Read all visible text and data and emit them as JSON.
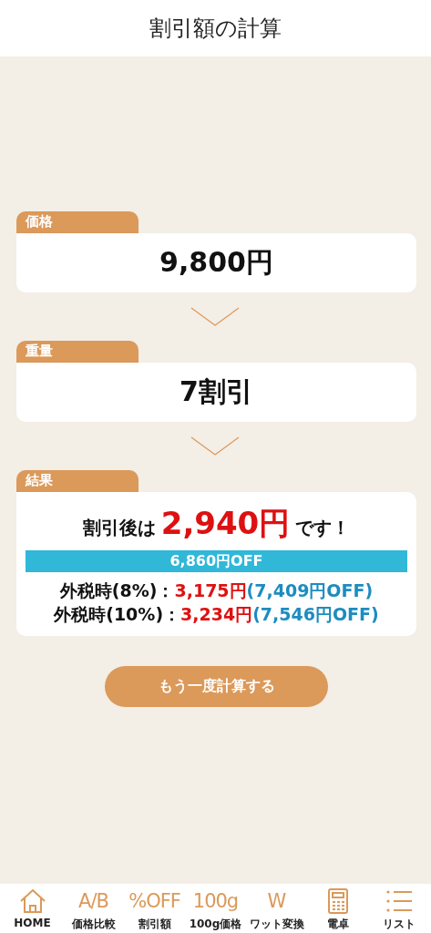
{
  "header": {
    "title": "割引額の計算"
  },
  "sections": [
    {
      "kind": "value",
      "label": "価格",
      "value": "9,800円"
    },
    {
      "kind": "value",
      "label": "重量",
      "value": "7割引"
    },
    {
      "kind": "result",
      "label": "結果",
      "prefix": "割引後は",
      "amount": "2,940円",
      "suffix": "です！",
      "off_banner": "6,860円OFF",
      "tax_rows": [
        {
          "label": "外税時(8%)：",
          "price": "3,175円",
          "off": "(7,409円OFF)"
        },
        {
          "label": "外税時(10%)：",
          "price": "3,234円",
          "off": "(7,546円OFF)"
        }
      ]
    }
  ],
  "button": {
    "label": "もう一度計算する"
  },
  "nav": [
    {
      "kind": "home",
      "label": "HOME"
    },
    {
      "kind": "text",
      "glyph": "A/B",
      "label": "価格比較"
    },
    {
      "kind": "text",
      "glyph": "%OFF",
      "label": "割引額"
    },
    {
      "kind": "text",
      "glyph": "100g",
      "label": "100g価格"
    },
    {
      "kind": "text",
      "glyph": "W",
      "label": "ワット変換"
    },
    {
      "kind": "calculator",
      "label": "電卓"
    },
    {
      "kind": "list",
      "label": "リスト"
    }
  ]
}
